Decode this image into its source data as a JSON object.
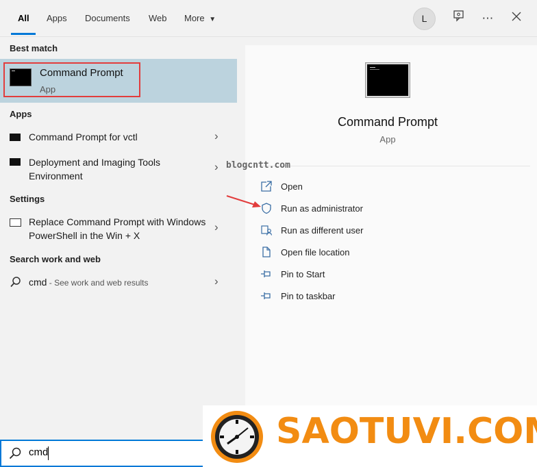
{
  "tabs": [
    {
      "label": "All",
      "active": true
    },
    {
      "label": "Apps"
    },
    {
      "label": "Documents"
    },
    {
      "label": "Web"
    },
    {
      "label": "More"
    }
  ],
  "toolbar": {
    "avatar_letter": "L",
    "feedback_icon": "feedback-icon",
    "more_icon": "ellipsis-icon",
    "close_icon": "close-icon"
  },
  "best_match": {
    "section_label": "Best match",
    "name": "Command Prompt",
    "type": "App"
  },
  "apps": {
    "section_label": "Apps",
    "items": [
      {
        "label": "Command Prompt for vctl"
      },
      {
        "label": "Deployment and Imaging Tools Environment"
      }
    ]
  },
  "settings": {
    "section_label": "Settings",
    "items": [
      {
        "label": "Replace Command Prompt with Windows PowerShell in the Win + X"
      }
    ]
  },
  "web": {
    "section_label": "Search work and web",
    "query": "cmd",
    "hint": " - See work and web results"
  },
  "preview": {
    "title": "Command Prompt",
    "subtitle": "App",
    "actions": [
      {
        "label": "Open",
        "icon": "open-icon"
      },
      {
        "label": "Run as administrator",
        "icon": "shield-icon"
      },
      {
        "label": "Run as different user",
        "icon": "user-icon"
      },
      {
        "label": "Open file location",
        "icon": "file-icon"
      },
      {
        "label": "Pin to Start",
        "icon": "pin-icon"
      },
      {
        "label": "Pin to taskbar",
        "icon": "pin-icon"
      }
    ]
  },
  "search_box": {
    "value": "cmd"
  },
  "watermarks": {
    "blog": "blogcntt.com",
    "logo": "SAOTUVI.COM"
  },
  "colors": {
    "accent": "#0078d7",
    "highlight": "#bcd3de",
    "annotation_red": "#e23c3c",
    "logo_orange": "#f28c12"
  }
}
